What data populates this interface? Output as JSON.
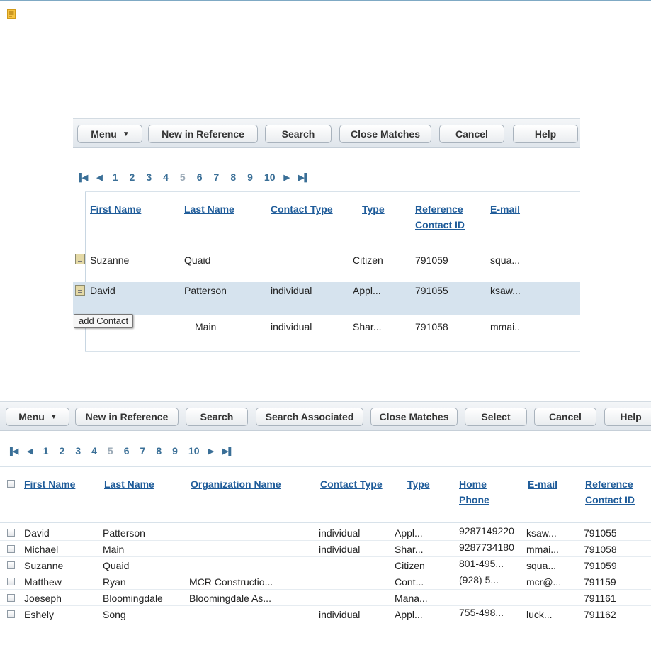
{
  "toolbar1": {
    "buttons": [
      "Menu",
      "New in Reference",
      "Search",
      "Close Matches",
      "Cancel",
      "Help"
    ]
  },
  "pager1": {
    "pages": [
      "1",
      "2",
      "3",
      "4",
      "5",
      "6",
      "7",
      "8",
      "9",
      "10"
    ],
    "current": "5"
  },
  "table1": {
    "columns": [
      "First Name",
      "Last Name",
      "Contact Type",
      "Type",
      "Reference",
      "Contact ID",
      "E-mail"
    ],
    "rows": [
      [
        "Suzanne",
        "Quaid",
        "",
        "Citizen",
        "791059",
        "squa..."
      ],
      [
        "David",
        "Patterson",
        "individual",
        "Appl...",
        "791055",
        "ksaw..."
      ],
      [
        "",
        "Main",
        "individual",
        "Shar...",
        "791058",
        "mmai.."
      ]
    ],
    "tooltip": "add Contact"
  },
  "toolbar2": {
    "buttons": [
      "Menu",
      "New in Reference",
      "Search",
      "Search Associated",
      "Close Matches",
      "Select",
      "Cancel",
      "Help"
    ]
  },
  "pager2": {
    "pages": [
      "1",
      "2",
      "3",
      "4",
      "5",
      "6",
      "7",
      "8",
      "9",
      "10"
    ],
    "current": "5"
  },
  "table2": {
    "columns": [
      "First Name",
      "Last Name",
      "Organization Name",
      "Contact Type",
      "Type",
      "Home",
      "Phone",
      "E-mail",
      "Reference",
      "Contact ID"
    ],
    "rows": [
      [
        "David",
        "Patterson",
        "",
        "individual",
        "Appl...",
        "9287149220",
        "ksaw...",
        "791055"
      ],
      [
        "Michael",
        "Main",
        "",
        "individual",
        "Shar...",
        "9287734180",
        "mmai...",
        "791058"
      ],
      [
        "Suzanne",
        "Quaid",
        "",
        "",
        "Citizen",
        "801-495...",
        "squa...",
        "791059"
      ],
      [
        "Matthew",
        "Ryan",
        "MCR Constructio...",
        "",
        "Cont...",
        "(928) 5...",
        "mcr@...",
        "791159"
      ],
      [
        "Joeseph",
        "Bloomingdale",
        "Bloomingdale As...",
        "",
        "Mana...",
        "",
        "",
        "791161"
      ],
      [
        "Eshely",
        "Song",
        "",
        "individual",
        "Appl...",
        "755-498...",
        "luck...",
        "791162"
      ]
    ]
  },
  "colors": {
    "link": "#1f5c9a",
    "selected_row": "#d6e3ee",
    "divider": "#7fa9c4"
  }
}
